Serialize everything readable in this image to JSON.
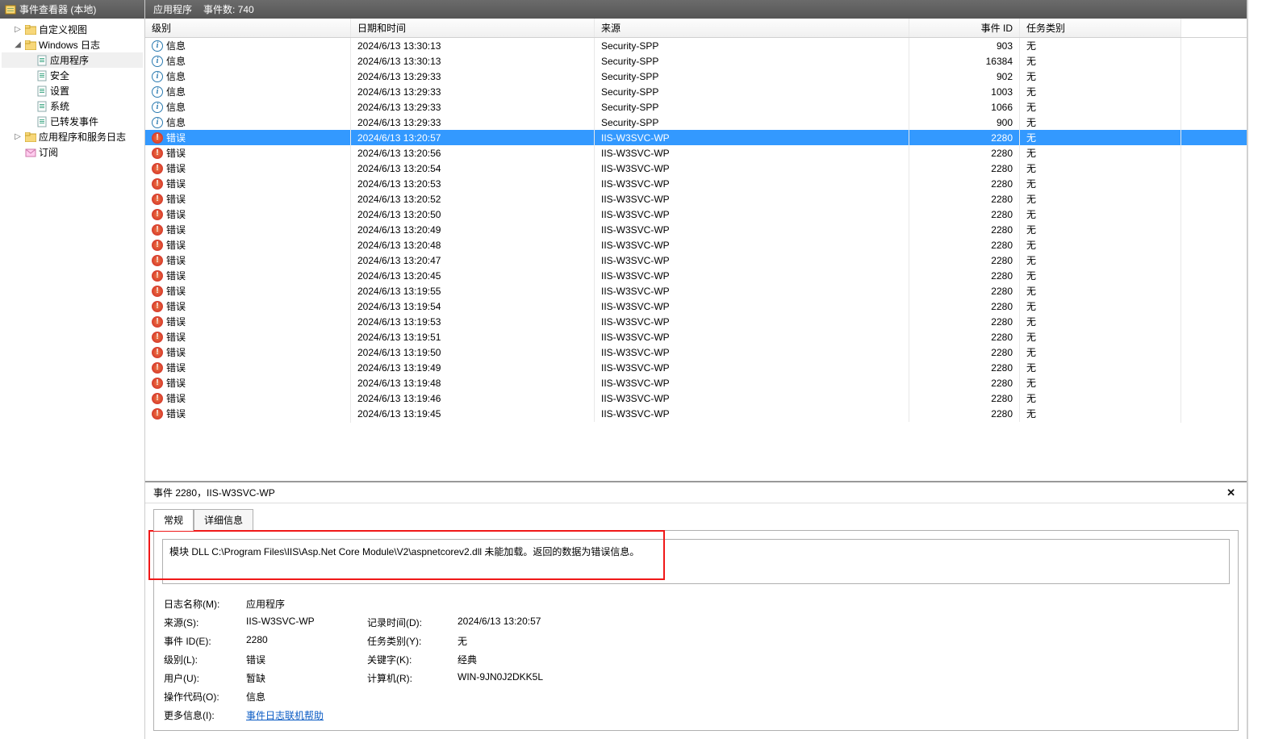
{
  "sidebar": {
    "title": "事件查看器 (本地)",
    "items": [
      {
        "name": "custom-views",
        "label": "自定义视图",
        "twisty": "▷",
        "indent": 1,
        "icon": "folder"
      },
      {
        "name": "windows-logs",
        "label": "Windows 日志",
        "twisty": "◢",
        "indent": 1,
        "icon": "folder"
      },
      {
        "name": "application",
        "label": "应用程序",
        "twisty": "",
        "indent": 2,
        "icon": "log",
        "selected": true
      },
      {
        "name": "security",
        "label": "安全",
        "twisty": "",
        "indent": 2,
        "icon": "log"
      },
      {
        "name": "setup",
        "label": "设置",
        "twisty": "",
        "indent": 2,
        "icon": "log"
      },
      {
        "name": "system",
        "label": "系统",
        "twisty": "",
        "indent": 2,
        "icon": "log"
      },
      {
        "name": "forwarded",
        "label": "已转发事件",
        "twisty": "",
        "indent": 2,
        "icon": "log"
      },
      {
        "name": "app-service-logs",
        "label": "应用程序和服务日志",
        "twisty": "▷",
        "indent": 1,
        "icon": "folder"
      },
      {
        "name": "subscriptions",
        "label": "订阅",
        "twisty": "",
        "indent": 1,
        "icon": "sub"
      }
    ]
  },
  "main": {
    "title": "应用程序",
    "count_label": "事件数:",
    "count_value": "740",
    "columns": {
      "level": "级别",
      "date": "日期和时间",
      "source": "来源",
      "id": "事件 ID",
      "category": "任务类别"
    },
    "rows": [
      {
        "lvl": "info",
        "lvl_txt": "信息",
        "date": "2024/6/13 13:30:13",
        "src": "Security-SPP",
        "id": "903",
        "cat": "无"
      },
      {
        "lvl": "info",
        "lvl_txt": "信息",
        "date": "2024/6/13 13:30:13",
        "src": "Security-SPP",
        "id": "16384",
        "cat": "无"
      },
      {
        "lvl": "info",
        "lvl_txt": "信息",
        "date": "2024/6/13 13:29:33",
        "src": "Security-SPP",
        "id": "902",
        "cat": "无"
      },
      {
        "lvl": "info",
        "lvl_txt": "信息",
        "date": "2024/6/13 13:29:33",
        "src": "Security-SPP",
        "id": "1003",
        "cat": "无"
      },
      {
        "lvl": "info",
        "lvl_txt": "信息",
        "date": "2024/6/13 13:29:33",
        "src": "Security-SPP",
        "id": "1066",
        "cat": "无"
      },
      {
        "lvl": "info",
        "lvl_txt": "信息",
        "date": "2024/6/13 13:29:33",
        "src": "Security-SPP",
        "id": "900",
        "cat": "无"
      },
      {
        "lvl": "err",
        "lvl_txt": "错误",
        "date": "2024/6/13 13:20:57",
        "src": "IIS-W3SVC-WP",
        "id": "2280",
        "cat": "无",
        "selected": true
      },
      {
        "lvl": "err",
        "lvl_txt": "错误",
        "date": "2024/6/13 13:20:56",
        "src": "IIS-W3SVC-WP",
        "id": "2280",
        "cat": "无"
      },
      {
        "lvl": "err",
        "lvl_txt": "错误",
        "date": "2024/6/13 13:20:54",
        "src": "IIS-W3SVC-WP",
        "id": "2280",
        "cat": "无"
      },
      {
        "lvl": "err",
        "lvl_txt": "错误",
        "date": "2024/6/13 13:20:53",
        "src": "IIS-W3SVC-WP",
        "id": "2280",
        "cat": "无"
      },
      {
        "lvl": "err",
        "lvl_txt": "错误",
        "date": "2024/6/13 13:20:52",
        "src": "IIS-W3SVC-WP",
        "id": "2280",
        "cat": "无"
      },
      {
        "lvl": "err",
        "lvl_txt": "错误",
        "date": "2024/6/13 13:20:50",
        "src": "IIS-W3SVC-WP",
        "id": "2280",
        "cat": "无"
      },
      {
        "lvl": "err",
        "lvl_txt": "错误",
        "date": "2024/6/13 13:20:49",
        "src": "IIS-W3SVC-WP",
        "id": "2280",
        "cat": "无"
      },
      {
        "lvl": "err",
        "lvl_txt": "错误",
        "date": "2024/6/13 13:20:48",
        "src": "IIS-W3SVC-WP",
        "id": "2280",
        "cat": "无"
      },
      {
        "lvl": "err",
        "lvl_txt": "错误",
        "date": "2024/6/13 13:20:47",
        "src": "IIS-W3SVC-WP",
        "id": "2280",
        "cat": "无"
      },
      {
        "lvl": "err",
        "lvl_txt": "错误",
        "date": "2024/6/13 13:20:45",
        "src": "IIS-W3SVC-WP",
        "id": "2280",
        "cat": "无"
      },
      {
        "lvl": "err",
        "lvl_txt": "错误",
        "date": "2024/6/13 13:19:55",
        "src": "IIS-W3SVC-WP",
        "id": "2280",
        "cat": "无"
      },
      {
        "lvl": "err",
        "lvl_txt": "错误",
        "date": "2024/6/13 13:19:54",
        "src": "IIS-W3SVC-WP",
        "id": "2280",
        "cat": "无"
      },
      {
        "lvl": "err",
        "lvl_txt": "错误",
        "date": "2024/6/13 13:19:53",
        "src": "IIS-W3SVC-WP",
        "id": "2280",
        "cat": "无"
      },
      {
        "lvl": "err",
        "lvl_txt": "错误",
        "date": "2024/6/13 13:19:51",
        "src": "IIS-W3SVC-WP",
        "id": "2280",
        "cat": "无"
      },
      {
        "lvl": "err",
        "lvl_txt": "错误",
        "date": "2024/6/13 13:19:50",
        "src": "IIS-W3SVC-WP",
        "id": "2280",
        "cat": "无"
      },
      {
        "lvl": "err",
        "lvl_txt": "错误",
        "date": "2024/6/13 13:19:49",
        "src": "IIS-W3SVC-WP",
        "id": "2280",
        "cat": "无"
      },
      {
        "lvl": "err",
        "lvl_txt": "错误",
        "date": "2024/6/13 13:19:48",
        "src": "IIS-W3SVC-WP",
        "id": "2280",
        "cat": "无"
      },
      {
        "lvl": "err",
        "lvl_txt": "错误",
        "date": "2024/6/13 13:19:46",
        "src": "IIS-W3SVC-WP",
        "id": "2280",
        "cat": "无"
      },
      {
        "lvl": "err",
        "lvl_txt": "错误",
        "date": "2024/6/13 13:19:45",
        "src": "IIS-W3SVC-WP",
        "id": "2280",
        "cat": "无"
      }
    ]
  },
  "detail": {
    "title": "事件 2280，IIS-W3SVC-WP",
    "close": "✕",
    "tabs": {
      "general": "常规",
      "details": "详细信息"
    },
    "message": "模块 DLL C:\\Program Files\\IIS\\Asp.Net Core Module\\V2\\aspnetcorev2.dll 未能加载。返回的数据为错误信息。",
    "fields": {
      "log_name_k": "日志名称(M):",
      "log_name_v": "应用程序",
      "source_k": "来源(S):",
      "source_v": "IIS-W3SVC-WP",
      "logged_k": "记录时间(D):",
      "logged_v": "2024/6/13 13:20:57",
      "event_id_k": "事件 ID(E):",
      "event_id_v": "2280",
      "task_cat_k": "任务类别(Y):",
      "task_cat_v": "无",
      "level_k": "级别(L):",
      "level_v": "错误",
      "keywords_k": "关键字(K):",
      "keywords_v": "经典",
      "user_k": "用户(U):",
      "user_v": "暂缺",
      "computer_k": "计算机(R):",
      "computer_v": "WIN-9JN0J2DKK5L",
      "opcode_k": "操作代码(O):",
      "opcode_v": "信息",
      "more_k": "更多信息(I):",
      "more_link": "事件日志联机帮助"
    }
  }
}
